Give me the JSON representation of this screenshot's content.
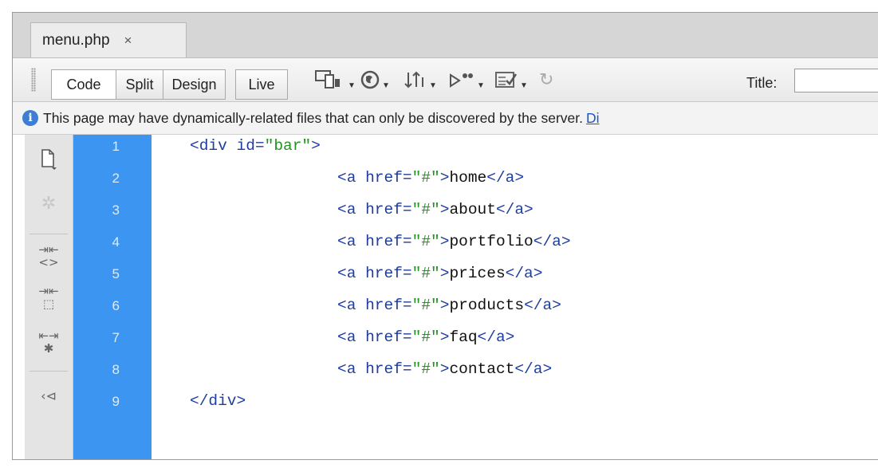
{
  "tab": {
    "label": "menu.php",
    "close": "×"
  },
  "toolbar": {
    "view_buttons": [
      "Code",
      "Split",
      "Design",
      "Live"
    ],
    "icons": [
      "multiscreen-icon",
      "globe-preview-icon",
      "file-transfer-icon",
      "debug-icon",
      "visual-aids-icon",
      "refresh-icon"
    ],
    "title_label": "Title:",
    "title_value": ""
  },
  "info": {
    "message": "This page may have dynamically-related files that can only be discovered by the server.",
    "link": "Di"
  },
  "side_toolbar": [
    "open-documents-icon",
    "settings-icon",
    "collapse-tag-icon",
    "collapse-selection-icon",
    "expand-all-icon",
    "select-parent-icon"
  ],
  "code": {
    "lines": [
      {
        "num": "1",
        "indent": "",
        "open": "<div id=",
        "value": "\"bar\"",
        "close": ">",
        "text": "",
        "end": ""
      },
      {
        "num": "2",
        "indent": "\t",
        "open": "<a href=",
        "value": "\"#\"",
        "close": ">",
        "text": "home",
        "end": "</a>"
      },
      {
        "num": "3",
        "indent": "\t",
        "open": "<a href=",
        "value": "\"#\"",
        "close": ">",
        "text": "about",
        "end": "</a>"
      },
      {
        "num": "4",
        "indent": "\t",
        "open": "<a href=",
        "value": "\"#\"",
        "close": ">",
        "text": "portfolio",
        "end": "</a>"
      },
      {
        "num": "5",
        "indent": "\t",
        "open": "<a href=",
        "value": "\"#\"",
        "close": ">",
        "text": "prices",
        "end": "</a>"
      },
      {
        "num": "6",
        "indent": "\t",
        "open": "<a href=",
        "value": "\"#\"",
        "close": ">",
        "text": "products",
        "end": "</a>"
      },
      {
        "num": "7",
        "indent": "\t",
        "open": "<a href=",
        "value": "\"#\"",
        "close": ">",
        "text": "faq",
        "end": "</a>"
      },
      {
        "num": "8",
        "indent": "\t",
        "open": "<a href=",
        "value": "\"#\"",
        "close": ">",
        "text": "contact",
        "end": "</a>"
      },
      {
        "num": "9",
        "indent": "",
        "open": "</div>",
        "value": "",
        "close": "",
        "text": "",
        "end": ""
      }
    ]
  },
  "colors": {
    "gutter": "#3d95f2",
    "tag": "#1f3d9e",
    "string": "#229322",
    "info_link": "#1a57c7"
  }
}
